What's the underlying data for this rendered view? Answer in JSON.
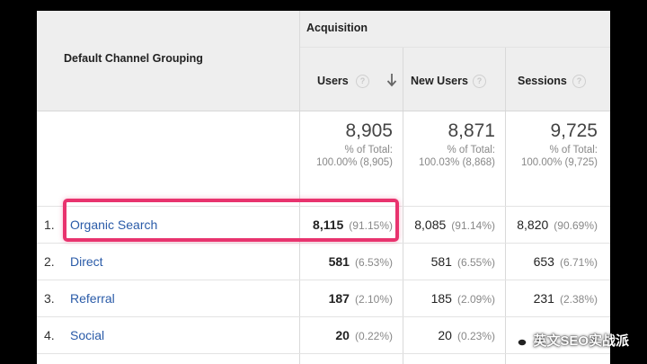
{
  "table": {
    "dimension_header": "Default Channel Grouping",
    "group_header": "Acquisition",
    "columns": [
      {
        "label": "Users",
        "help": "?"
      },
      {
        "label": "New Users",
        "help": "?"
      },
      {
        "label": "Sessions",
        "help": "?"
      }
    ],
    "totals": [
      {
        "value": "8,905",
        "line1": "% of Total:",
        "line2": "100.00% (8,905)"
      },
      {
        "value": "8,871",
        "line1": "% of Total:",
        "line2": "100.03% (8,868)"
      },
      {
        "value": "9,725",
        "line1": "% of Total:",
        "line2": "100.00% (9,725)"
      }
    ],
    "rows": [
      {
        "index": "1.",
        "channel": "Organic Search",
        "users": "8,115",
        "users_pct": "(91.15%)",
        "new_users": "8,085",
        "new_users_pct": "(91.14%)",
        "sessions": "8,820",
        "sessions_pct": "(90.69%)"
      },
      {
        "index": "2.",
        "channel": "Direct",
        "users": "581",
        "users_pct": "(6.53%)",
        "new_users": "581",
        "new_users_pct": "(6.55%)",
        "sessions": "653",
        "sessions_pct": "(6.71%)"
      },
      {
        "index": "3.",
        "channel": "Referral",
        "users": "187",
        "users_pct": "(2.10%)",
        "new_users": "185",
        "new_users_pct": "(2.09%)",
        "sessions": "231",
        "sessions_pct": "(2.38%)"
      },
      {
        "index": "4.",
        "channel": "Social",
        "users": "20",
        "users_pct": "(0.22%)",
        "new_users": "20",
        "new_users_pct": "(0.23%)",
        "sessions": "",
        "sessions_pct": ""
      }
    ]
  },
  "watermark": {
    "text": "英文SEO实战派",
    "icon": "wechat-icon"
  },
  "colors": {
    "highlight": "#e8336e",
    "link": "#2a5ba8",
    "header_bg": "#eeeeee"
  }
}
